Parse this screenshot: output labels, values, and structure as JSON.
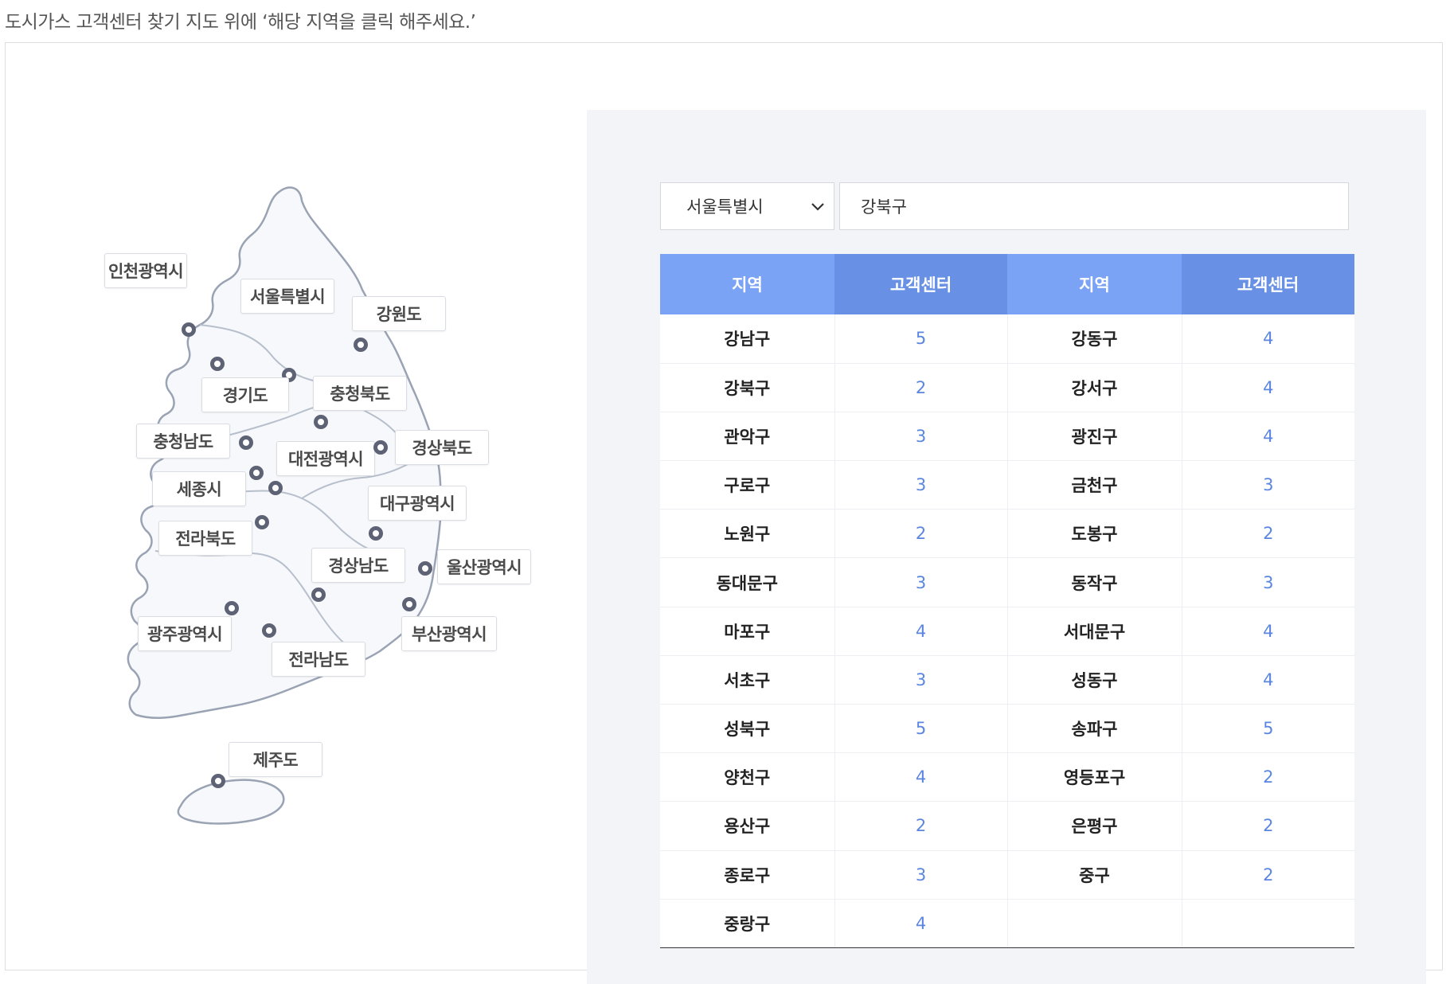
{
  "intro_text": "도시가스 고객센터 찾기 지도 위에 ‘해당 지역을 클릭 해주세요.’",
  "map": {
    "regions": [
      {
        "key": "incheon",
        "label": "인천광역시"
      },
      {
        "key": "seoul",
        "label": "서울특별시"
      },
      {
        "key": "gangwon",
        "label": "강원도"
      },
      {
        "key": "gyeonggi",
        "label": "경기도"
      },
      {
        "key": "chungbuk",
        "label": "충청북도"
      },
      {
        "key": "chungnam",
        "label": "충청남도"
      },
      {
        "key": "daejeon",
        "label": "대전광역시"
      },
      {
        "key": "gyeongbuk",
        "label": "경상북도"
      },
      {
        "key": "sejong",
        "label": "세종시"
      },
      {
        "key": "daegu",
        "label": "대구광역시"
      },
      {
        "key": "jeonbuk",
        "label": "전라북도"
      },
      {
        "key": "gyeongnam",
        "label": "경상남도"
      },
      {
        "key": "ulsan",
        "label": "울산광역시"
      },
      {
        "key": "gwangju",
        "label": "광주광역시"
      },
      {
        "key": "busan",
        "label": "부산광역시"
      },
      {
        "key": "jeonnam",
        "label": "전라남도"
      },
      {
        "key": "jeju",
        "label": "제주도"
      }
    ]
  },
  "colors": {
    "header_a": "#7aa2f5",
    "header_b": "#6890e4",
    "count_text": "#5b86e0",
    "panel_bg": "#f3f4f8",
    "pin": "#5d6275"
  },
  "filter": {
    "city": "서울특별시",
    "district": "강북구",
    "chevron_icon": "chevron-down-icon"
  },
  "table": {
    "headers": [
      "지역",
      "고객센터",
      "지역",
      "고객센터"
    ],
    "rows": [
      [
        "강남구",
        "5",
        "강동구",
        "4"
      ],
      [
        "강북구",
        "2",
        "강서구",
        "4"
      ],
      [
        "관악구",
        "3",
        "광진구",
        "4"
      ],
      [
        "구로구",
        "3",
        "금천구",
        "3"
      ],
      [
        "노원구",
        "2",
        "도봉구",
        "2"
      ],
      [
        "동대문구",
        "3",
        "동작구",
        "3"
      ],
      [
        "마포구",
        "4",
        "서대문구",
        "4"
      ],
      [
        "서초구",
        "3",
        "성동구",
        "4"
      ],
      [
        "성북구",
        "5",
        "송파구",
        "5"
      ],
      [
        "양천구",
        "4",
        "영등포구",
        "2"
      ],
      [
        "용산구",
        "2",
        "은평구",
        "2"
      ],
      [
        "종로구",
        "3",
        "중구",
        "2"
      ],
      [
        "중랑구",
        "4",
        "",
        ""
      ]
    ]
  }
}
